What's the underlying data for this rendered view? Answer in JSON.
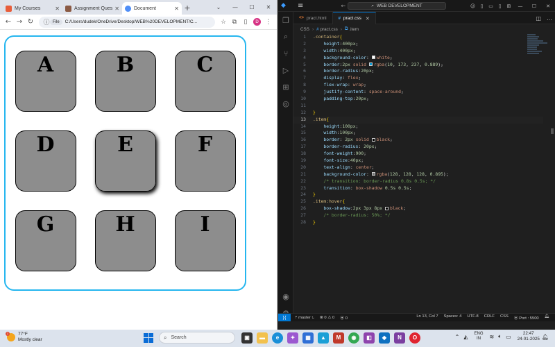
{
  "chrome": {
    "tabs": [
      {
        "title": "My Courses",
        "favicon_color": "#e85d3a",
        "active": false
      },
      {
        "title": "Assignment Quest",
        "favicon_color": "#8a5a44",
        "active": false
      },
      {
        "title": "Document",
        "favicon_color": "#4f8ef7",
        "active": true
      }
    ],
    "new_tab": "+",
    "address": {
      "chip": "File",
      "url": "C:/Users/dudek/OneDrive/Desktop/WEB%20DEVELOPMENT/C..."
    },
    "profile_initial": "D"
  },
  "page": {
    "items": [
      "A",
      "B",
      "C",
      "D",
      "E",
      "F",
      "G",
      "H",
      "I"
    ],
    "hovered_item": "E"
  },
  "vscode": {
    "search": "WEB DEVELOPMENT",
    "tabs": [
      {
        "name": "pract.html",
        "icon": "<>",
        "active": false
      },
      {
        "name": "pract.css",
        "icon": "#",
        "active": true
      }
    ],
    "breadcrumb": [
      "CSS",
      "pract.css",
      ".item"
    ],
    "status": {
      "branch": "master",
      "errors": "0",
      "warnings": "0",
      "ports": "0",
      "position": "Ln 13, Col 7",
      "spaces": "Spaces: 4",
      "encoding": "UTF-8",
      "eol": "CRLF",
      "language": "CSS",
      "port": "Port : 5500"
    },
    "code_lines": [
      {
        "n": "1",
        "html": "<span class='sel'>.container</span><span class='brk'>{</span>"
      },
      {
        "n": "2",
        "html": "    <span class='prop'>height</span><span class='pun'>:</span><span class='num'>400px</span><span class='pun'>;</span>"
      },
      {
        "n": "3",
        "html": "    <span class='prop'>width</span><span class='pun'>:</span><span class='num'>400px</span><span class='pun'>;</span>"
      },
      {
        "n": "4",
        "html": "    <span class='prop'>background-color</span><span class='pun'>: </span><span class='sw' style='background:#fff'></span><span class='val'>white</span><span class='pun'>;</span>"
      },
      {
        "n": "5",
        "html": "    <span class='prop'>border</span><span class='pun'>:</span><span class='num'>2px</span> <span class='val'>solid</span> <span class='sw' style='background:rgba(10,173,237,0.889)'></span><span class='val'>rgba</span><span class='pun'>(</span><span class='num'>10</span><span class='pun'>, </span><span class='num'>173</span><span class='pun'>, </span><span class='num'>237</span><span class='pun'>, </span><span class='num'>0.889</span><span class='pun'>);</span>"
      },
      {
        "n": "6",
        "html": "    <span class='prop'>border-radius</span><span class='pun'>:</span><span class='num'>20px</span><span class='pun'>;</span>"
      },
      {
        "n": "7",
        "html": "    <span class='prop'>display</span><span class='pun'>: </span><span class='val'>flex</span><span class='pun'>;</span>"
      },
      {
        "n": "8",
        "html": "    <span class='prop'>flex-wrap</span><span class='pun'>: </span><span class='val'>wrap</span><span class='pun'>;</span>"
      },
      {
        "n": "9",
        "html": "    <span class='prop'>justify-content</span><span class='pun'>: </span><span class='val'>space-around</span><span class='pun'>;</span>"
      },
      {
        "n": "10",
        "html": "    <span class='prop'>padding-top</span><span class='pun'>:</span><span class='num'>20px</span><span class='pun'>;</span>"
      },
      {
        "n": "11",
        "html": ""
      },
      {
        "n": "12",
        "html": "<span class='brk'>}</span>"
      },
      {
        "n": "13",
        "html": "<span class='sel'>.item</span><span class='brk'>{</span>",
        "current": true
      },
      {
        "n": "14",
        "html": "    <span class='prop'>height</span><span class='pun'>:</span><span class='num'>100px</span><span class='pun'>;</span>"
      },
      {
        "n": "15",
        "html": "    <span class='prop'>width</span><span class='pun'>:</span><span class='num'>100px</span><span class='pun'>;</span>"
      },
      {
        "n": "16",
        "html": "    <span class='prop'>border</span><span class='pun'>: </span><span class='num'>2px</span> <span class='val'>solid</span> <span class='sw' style='background:#000'></span><span class='val'>black</span><span class='pun'>;</span>"
      },
      {
        "n": "17",
        "html": "    <span class='prop'>border-radius</span><span class='pun'>: </span><span class='num'>20px</span><span class='pun'>;</span>"
      },
      {
        "n": "18",
        "html": "    <span class='prop'>font-weight</span><span class='pun'>:</span><span class='num'>900</span><span class='pun'>;</span>"
      },
      {
        "n": "19",
        "html": "    <span class='prop'>font-size</span><span class='pun'>:</span><span class='num'>40px</span><span class='pun'>;</span>"
      },
      {
        "n": "20",
        "html": "    <span class='prop'>text-align</span><span class='pun'>: </span><span class='val'>center</span><span class='pun'>;</span>"
      },
      {
        "n": "21",
        "html": "    <span class='prop'>background-color</span><span class='pun'>: </span><span class='sw' style='background:rgba(128,128,128,0.895)'></span><span class='val'>rgba</span><span class='pun'>(</span><span class='num'>128</span><span class='pun'>, </span><span class='num'>128</span><span class='pun'>, </span><span class='num'>128</span><span class='pun'>, </span><span class='num'>0.895</span><span class='pun'>);</span>"
      },
      {
        "n": "22",
        "html": "    <span class='cmt'>/* transition: border-radius 0.8s 0.5s; */</span>"
      },
      {
        "n": "23",
        "html": "    <span class='prop'>transition</span><span class='pun'>: </span><span class='val'>box-shadow</span> <span class='num'>0.5s</span> <span class='num'>0.5s</span><span class='pun'>;</span>"
      },
      {
        "n": "24",
        "html": "<span class='brk'>}</span>"
      },
      {
        "n": "25",
        "html": "<span class='sel'>.item:hover</span><span class='brk'>{</span>"
      },
      {
        "n": "26",
        "html": "    <span class='prop'>box-shadow</span><span class='pun'>:</span><span class='num'>2px</span> <span class='num'>3px</span> <span class='num'>8px</span> <span class='sw' style='background:#000'></span><span class='val'>black</span><span class='pun'>;</span>"
      },
      {
        "n": "27",
        "html": "    <span class='cmt'>/* border-radius: 50%; */</span>"
      },
      {
        "n": "28",
        "html": "<span class='brk'>}</span>"
      }
    ]
  },
  "taskbar": {
    "weather_temp": "77°F",
    "weather_desc": "Mostly clear",
    "search_placeholder": "Search",
    "lang_line1": "ENG",
    "lang_line2": "IN",
    "time": "22:47",
    "date": "24-01-2025"
  }
}
